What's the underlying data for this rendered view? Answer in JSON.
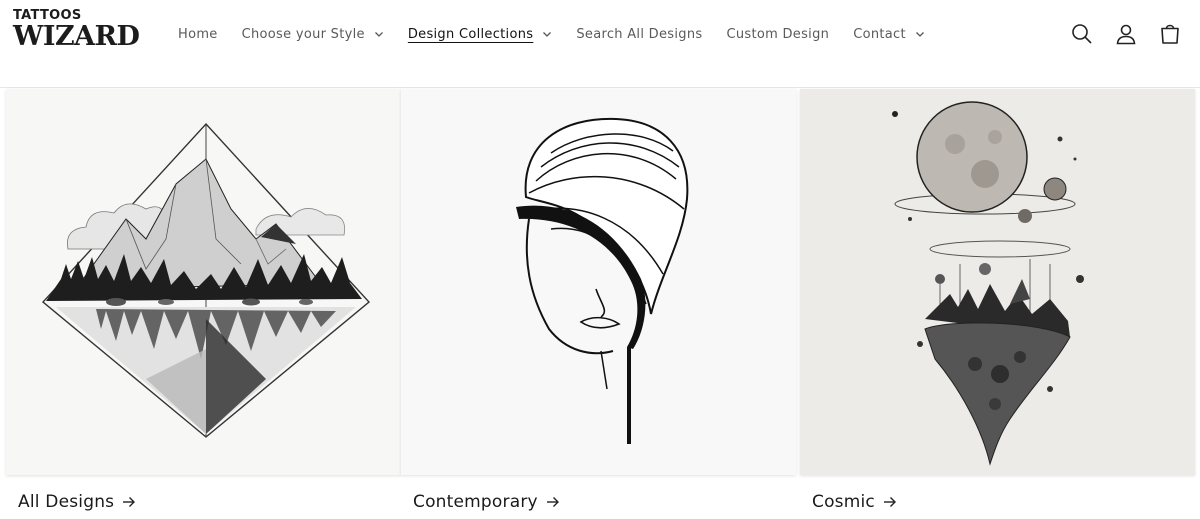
{
  "brand": {
    "top": "TATTOOS",
    "main": "WIZARD"
  },
  "nav": [
    {
      "label": "Home",
      "has_dropdown": false,
      "active": false
    },
    {
      "label": "Choose your Style",
      "has_dropdown": true,
      "active": false
    },
    {
      "label": "Design Collections",
      "has_dropdown": true,
      "active": true
    },
    {
      "label": "Search All Designs",
      "has_dropdown": false,
      "active": false
    },
    {
      "label": "Custom Design",
      "has_dropdown": false,
      "active": false
    },
    {
      "label": "Contact",
      "has_dropdown": true,
      "active": false
    }
  ],
  "header_icons": [
    "search-icon",
    "account-icon",
    "cart-icon"
  ],
  "collections": [
    {
      "title": "All Designs",
      "image": "mountain-lake-diamond-tattoo"
    },
    {
      "title": "Contemporary",
      "image": "line-art-face-tattoo"
    },
    {
      "title": "Cosmic",
      "image": "planet-floating-island-tattoo"
    }
  ],
  "colors": {
    "text": "#121212",
    "nav_text": "#5a5a5a",
    "card_bg": "#f6f6f5"
  }
}
